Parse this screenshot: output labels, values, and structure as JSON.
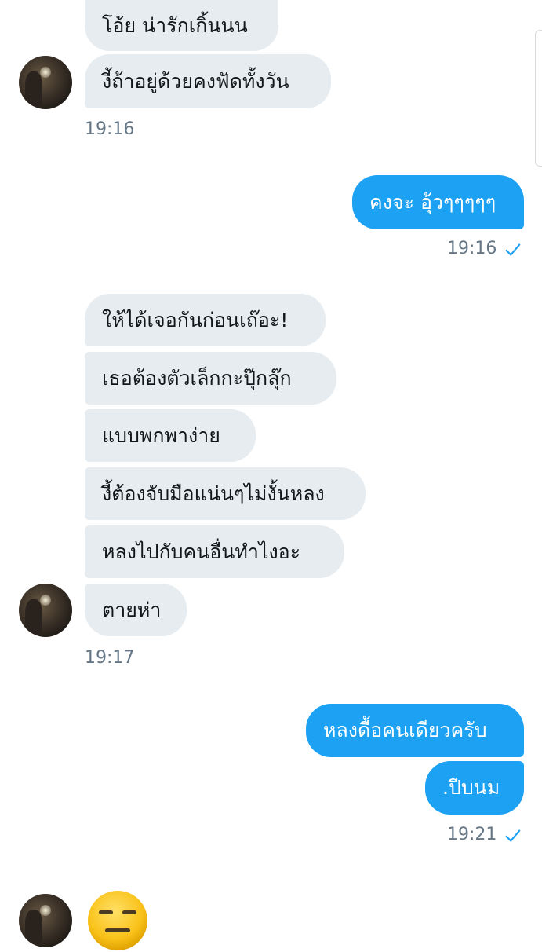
{
  "messages": {
    "group1": [
      "โอ้ย น่ารักเกิ้นนน",
      "งี้ถ้าอยู่ด้วยคงฟัดทั้งวัน"
    ],
    "time1": "19:16",
    "reply1": [
      "คงจะ อุ้วๆๆๆๆๆ"
    ],
    "time2": "19:16",
    "group2": [
      "ให้ได้เจอกันก่อนเถ๊อะ!",
      "เธอต้องตัวเล็กกะปุ๊กลุ๊ก",
      "แบบพกพาง่าย",
      "งี้ต้องจับมือแน่นๆไม่งั้นหลง",
      "หลงไปกับคนอื่นทำไงอะ",
      "ตายห่า"
    ],
    "time3": "19:17",
    "reply2": [
      "หลงดื้อคนเดียวครับ",
      ".ปีบนม"
    ],
    "time4": "19:21"
  },
  "colors": {
    "incoming_bubble": "#e6ecf0",
    "outgoing_bubble": "#1da1f2",
    "timestamp": "#657786",
    "read_check": "#1da1f2"
  },
  "icons": {
    "read_receipt": "check-icon",
    "last_message": "expressionless-face-emoji"
  }
}
